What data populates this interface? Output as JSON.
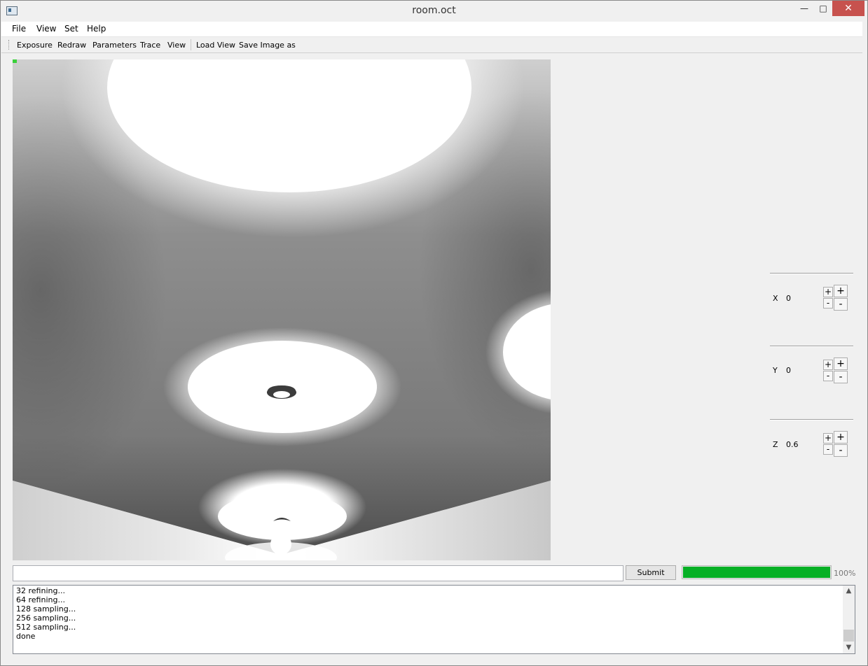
{
  "window": {
    "title": "room.oct",
    "minimize_glyph": "—",
    "maximize_glyph": "□",
    "close_glyph": "✕"
  },
  "menu": [
    "File",
    "View",
    "Set",
    "Help"
  ],
  "toolbar": {
    "group1": [
      "Exposure",
      "Redraw",
      "Parameters",
      "Trace",
      "View"
    ],
    "group2": [
      "Load View",
      "Save Image as"
    ]
  },
  "coords": [
    {
      "label": "X",
      "value": "0"
    },
    {
      "label": "Y",
      "value": "0"
    },
    {
      "label": "Z",
      "value": "0.6"
    }
  ],
  "stepper": {
    "plus": "+",
    "minus": "-"
  },
  "command": {
    "value": "",
    "submit_label": "Submit"
  },
  "progress": {
    "percent": 100,
    "label": "100%",
    "color": "#06b025"
  },
  "log": {
    "lines": [
      "32 refining...",
      "64 refining...",
      "128 sampling...",
      "256 sampling...",
      "512 sampling...",
      "done"
    ],
    "up_glyph": "▲",
    "down_glyph": "▼"
  }
}
